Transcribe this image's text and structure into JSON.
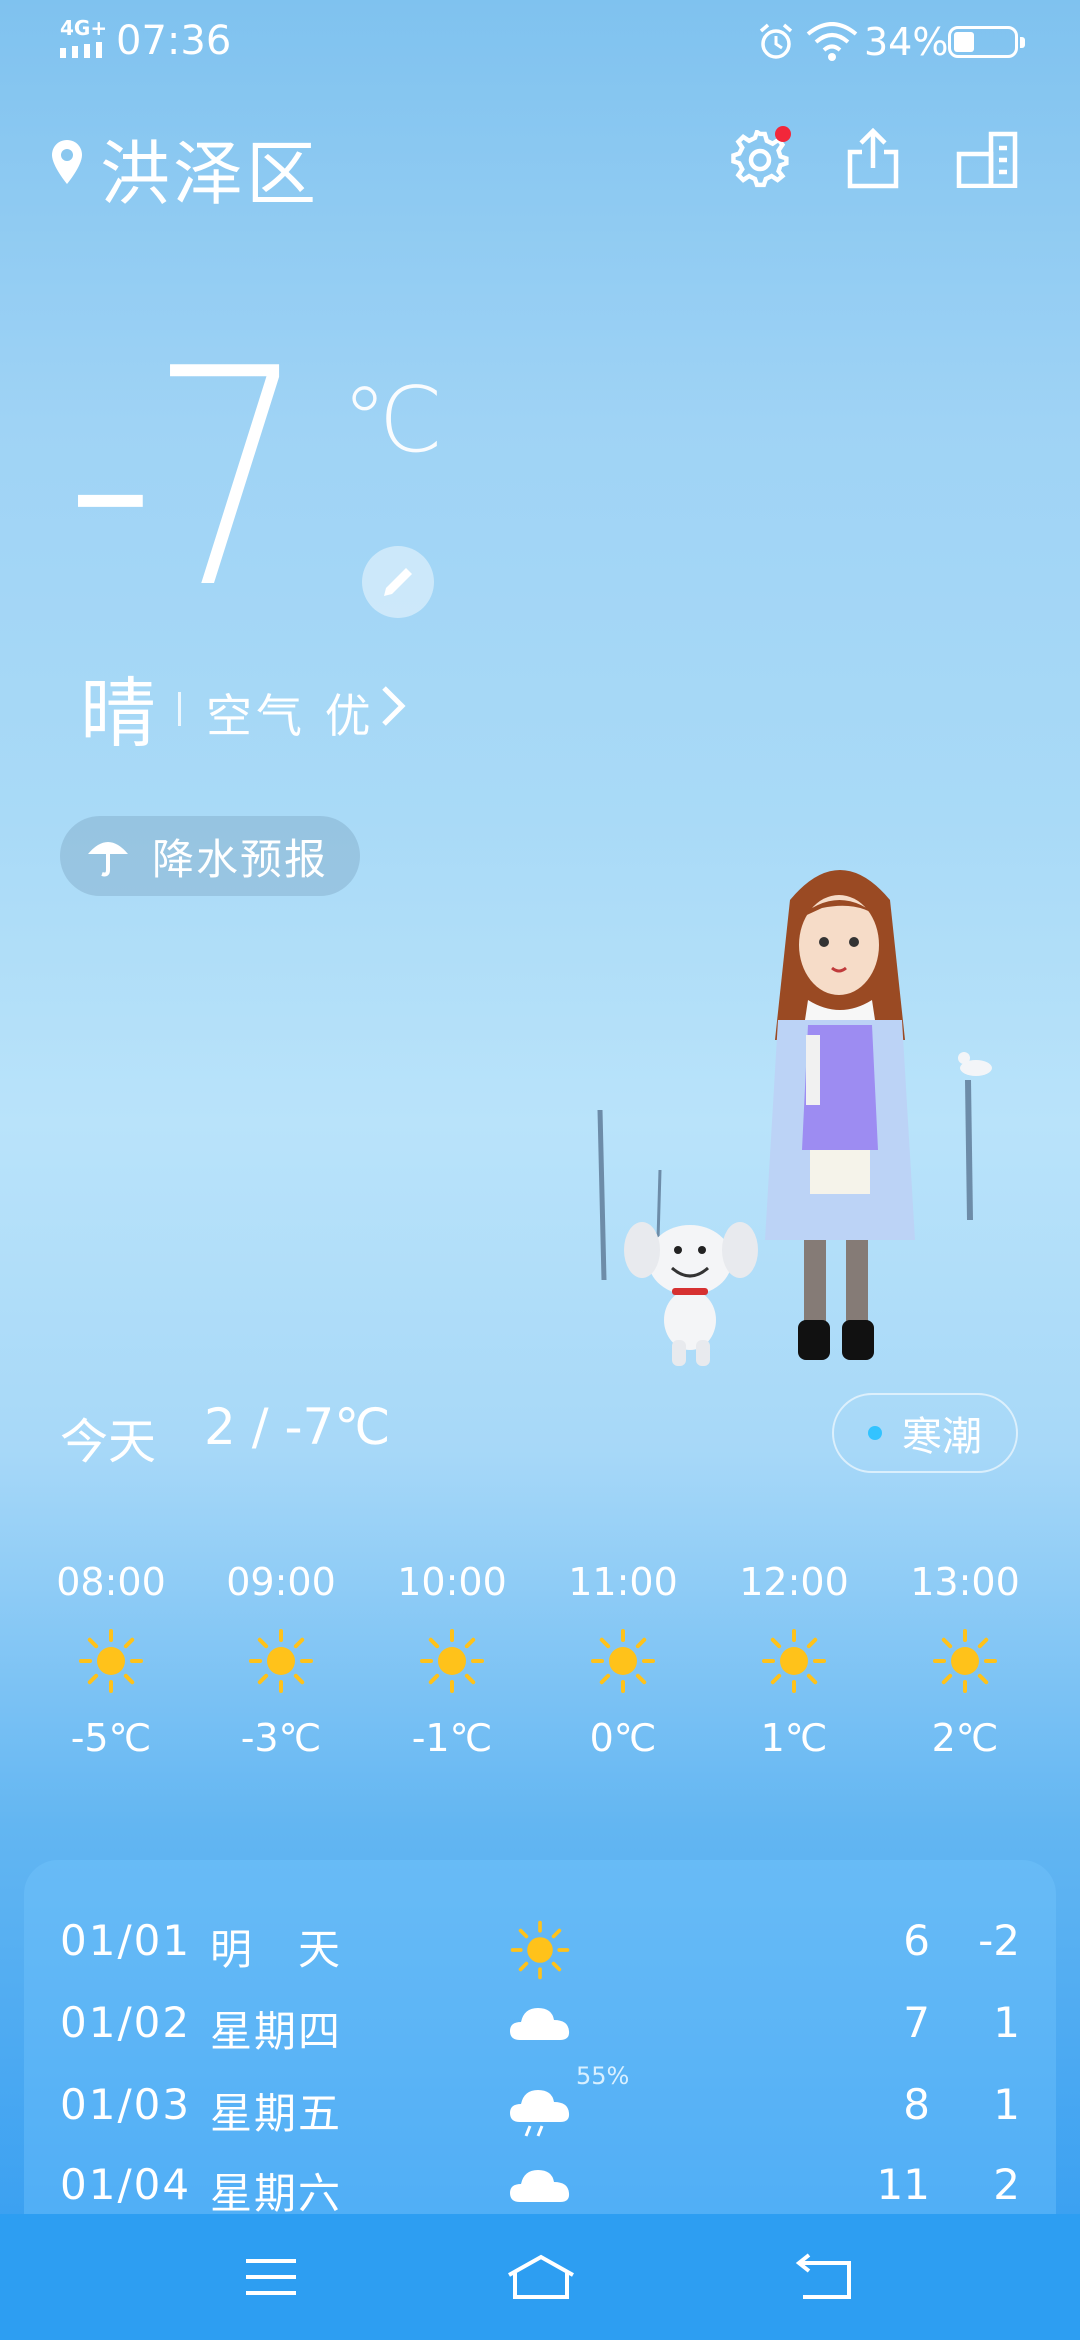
{
  "status_bar": {
    "network": "4G+",
    "time": "07:36",
    "battery": "34%",
    "battery_level": 0.34
  },
  "header": {
    "location": "洪泽区"
  },
  "current": {
    "temperature": "-7",
    "unit": "℃",
    "condition": "晴",
    "air_quality": "空气 优"
  },
  "precipitation_button": {
    "label": "降水预报"
  },
  "today": {
    "label": "今天",
    "range": "2 / -7℃",
    "tag": "寒潮"
  },
  "hourly": [
    {
      "time": "08:00",
      "icon": "sun-icon",
      "temp": "-5℃"
    },
    {
      "time": "09:00",
      "icon": "sun-icon",
      "temp": "-3℃"
    },
    {
      "time": "10:00",
      "icon": "sun-icon",
      "temp": "-1℃"
    },
    {
      "time": "11:00",
      "icon": "sun-icon",
      "temp": "0℃"
    },
    {
      "time": "12:00",
      "icon": "sun-icon",
      "temp": "1℃"
    },
    {
      "time": "13:00",
      "icon": "sun-icon",
      "temp": "2℃"
    }
  ],
  "daily": [
    {
      "date": "01/01",
      "weekday": "明　天",
      "icon": "sun-icon",
      "pop": "",
      "high": "6",
      "low": "-2"
    },
    {
      "date": "01/02",
      "weekday": "星期四",
      "icon": "cloud-icon",
      "pop": "",
      "high": "7",
      "low": "1"
    },
    {
      "date": "01/03",
      "weekday": "星期五",
      "icon": "rain-cloud-icon",
      "pop": "55%",
      "high": "8",
      "low": "1"
    },
    {
      "date": "01/04",
      "weekday": "星期六",
      "icon": "cloud-icon",
      "pop": "",
      "high": "11",
      "low": "2"
    }
  ],
  "colors": {
    "notification_dot": "#f2273a",
    "tag_dot": "#33c3ff",
    "sun": "#ffc21a",
    "navbar": "#2d9ef2"
  }
}
